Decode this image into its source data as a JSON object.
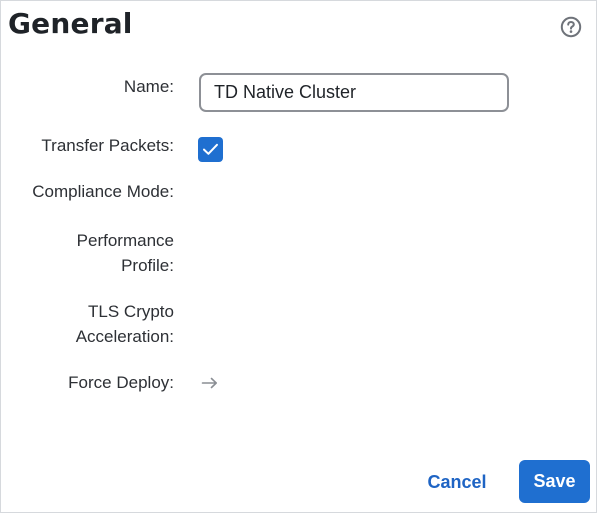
{
  "dialog": {
    "title": "General",
    "help_icon": "question-circle-icon"
  },
  "fields": {
    "name": {
      "label": "Name:",
      "value": "TD Native Cluster"
    },
    "transfer_packets": {
      "label": "Transfer Packets:",
      "checked": true,
      "icon": "checkmark-icon"
    },
    "compliance_mode": {
      "label": "Compliance Mode:"
    },
    "performance_profile": {
      "label_line1": "Performance",
      "label_line2": "Profile:"
    },
    "tls_crypto": {
      "label_line1": "TLS Crypto",
      "label_line2": "Acceleration:"
    },
    "force_deploy": {
      "label": "Force Deploy:",
      "icon": "arrow-right-icon"
    }
  },
  "actions": {
    "cancel_label": "Cancel",
    "save_label": "Save"
  },
  "colors": {
    "accent": "#1f6fd0",
    "link": "#1e64c4",
    "text": "#2d3035",
    "border": "#d6d9dd"
  }
}
